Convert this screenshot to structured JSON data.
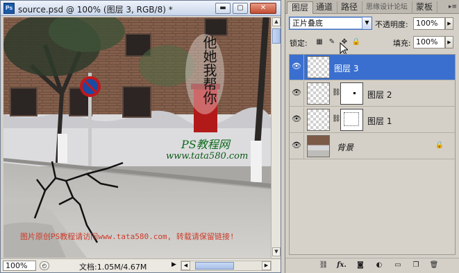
{
  "document": {
    "app_icon": "Ps",
    "title": "source.psd @ 100% (图层 3, RGB/8) *",
    "buttons": {
      "minimize": "▬",
      "restore": "▢",
      "close": "✕"
    },
    "canvas": {
      "calligraphy": "他她我帮你",
      "logo_title": "PS教程网",
      "logo_url": "www.tata580.com",
      "watermark": "图片原创PS教程请访问www.tata580.com, 转载请保留链接!"
    },
    "status": {
      "zoom": "100%",
      "info": "文档:1.05M/4.67M"
    }
  },
  "panel": {
    "tabs": [
      {
        "label": "图层"
      },
      {
        "label": "通道"
      },
      {
        "label": "路径"
      },
      {
        "label": "思缘设计论坛"
      },
      {
        "label": "蒙板"
      }
    ],
    "blend_mode": "正片叠底",
    "opacity_label": "不透明度:",
    "opacity_value": "100%",
    "lock_label": "锁定:",
    "fill_label": "填充:",
    "fill_value": "100%",
    "layers": [
      {
        "name": "图层 3",
        "selected": true,
        "has_mask": false
      },
      {
        "name": "图层 2",
        "selected": false,
        "has_mask": true
      },
      {
        "name": "图层 1",
        "selected": false,
        "has_mask": true
      },
      {
        "name": "背景",
        "selected": false,
        "has_mask": false,
        "locked": true
      }
    ],
    "bottom_icons": [
      "link-icon",
      "fx-icon",
      "mask-icon",
      "adjustment-icon",
      "group-icon",
      "new-layer-icon",
      "trash-icon"
    ],
    "fx_label": "fx."
  },
  "colors": {
    "selection": "#3a6fcf",
    "panel_bg": "#d4d0c8"
  }
}
